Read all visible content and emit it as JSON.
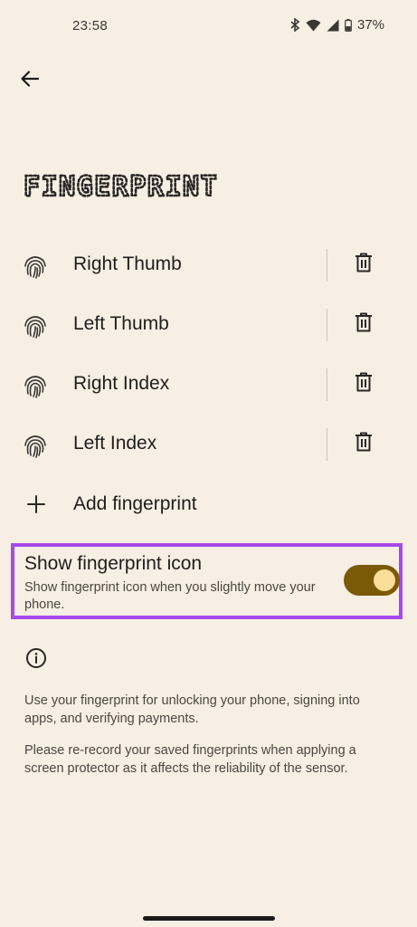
{
  "status_bar": {
    "time": "23:58",
    "battery": "37%"
  },
  "header": {
    "back_icon": "arrow-left-icon",
    "title": "FINGERPRINT"
  },
  "fingerprints": [
    {
      "label": "Right Thumb",
      "icon": "fingerprint-icon",
      "action_icon": "trash-icon"
    },
    {
      "label": "Left Thumb",
      "icon": "fingerprint-icon",
      "action_icon": "trash-icon"
    },
    {
      "label": "Right Index",
      "icon": "fingerprint-icon",
      "action_icon": "trash-icon"
    },
    {
      "label": "Left Index",
      "icon": "fingerprint-icon",
      "action_icon": "trash-icon"
    }
  ],
  "add": {
    "label": "Add fingerprint",
    "icon": "plus-icon"
  },
  "show_icon_setting": {
    "title": "Show fingerprint icon",
    "subtitle": "Show fingerprint icon when you slightly move your phone.",
    "enabled": true
  },
  "info": {
    "icon": "info-icon",
    "paragraph1": "Use your fingerprint for unlocking your phone, signing into apps, and verifying payments.",
    "paragraph2": "Please re-record your saved fingerprints when applying a screen protector as it affects the reliability of the sensor."
  },
  "colors": {
    "background": "#f7eee4",
    "accent": "#7a5a06",
    "toggle_thumb": "#fbdd9a",
    "highlight": "#a64ae8"
  }
}
